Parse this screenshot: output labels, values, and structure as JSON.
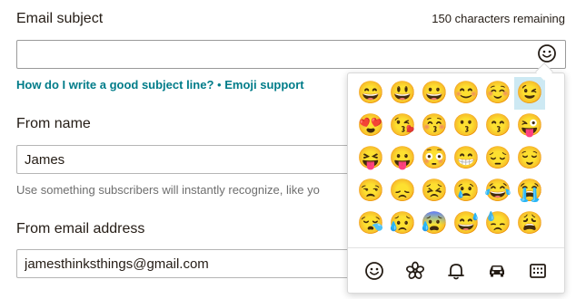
{
  "subject": {
    "label": "Email subject",
    "counter": "150 characters remaining",
    "value": "",
    "emoji_button_icon": "smiley-icon",
    "help_link_1": "How do I write a good subject line?",
    "separator": "•",
    "help_link_2": "Emoji support"
  },
  "from_name": {
    "label": "From name",
    "value": "James",
    "hint": "Use something subscribers will instantly recognize, like yo"
  },
  "from_email": {
    "label": "From email address",
    "value": "jamesthinksthings@gmail.com"
  },
  "emoji_picker": {
    "selected_index": 5,
    "emojis": [
      "😄",
      "😃",
      "😀",
      "😊",
      "☺️",
      "😉",
      "😍",
      "😘",
      "😚",
      "😗",
      "😙",
      "😜",
      "😝",
      "😛",
      "😳",
      "😁",
      "😔",
      "😌",
      "😒",
      "😞",
      "😣",
      "😢",
      "😂",
      "😭",
      "😪",
      "😥",
      "😰",
      "😅",
      "😓",
      "😩"
    ],
    "categories": [
      {
        "name": "people",
        "icon": "smiley-icon"
      },
      {
        "name": "nature",
        "icon": "flower-icon"
      },
      {
        "name": "objects",
        "icon": "bell-icon"
      },
      {
        "name": "places",
        "icon": "car-icon"
      },
      {
        "name": "symbols",
        "icon": "symbols-icon"
      }
    ]
  },
  "colors": {
    "link": "#007c89",
    "text": "#241c15",
    "hint": "#6e6e6e",
    "selected_emoji_bg": "#cde9f3"
  }
}
